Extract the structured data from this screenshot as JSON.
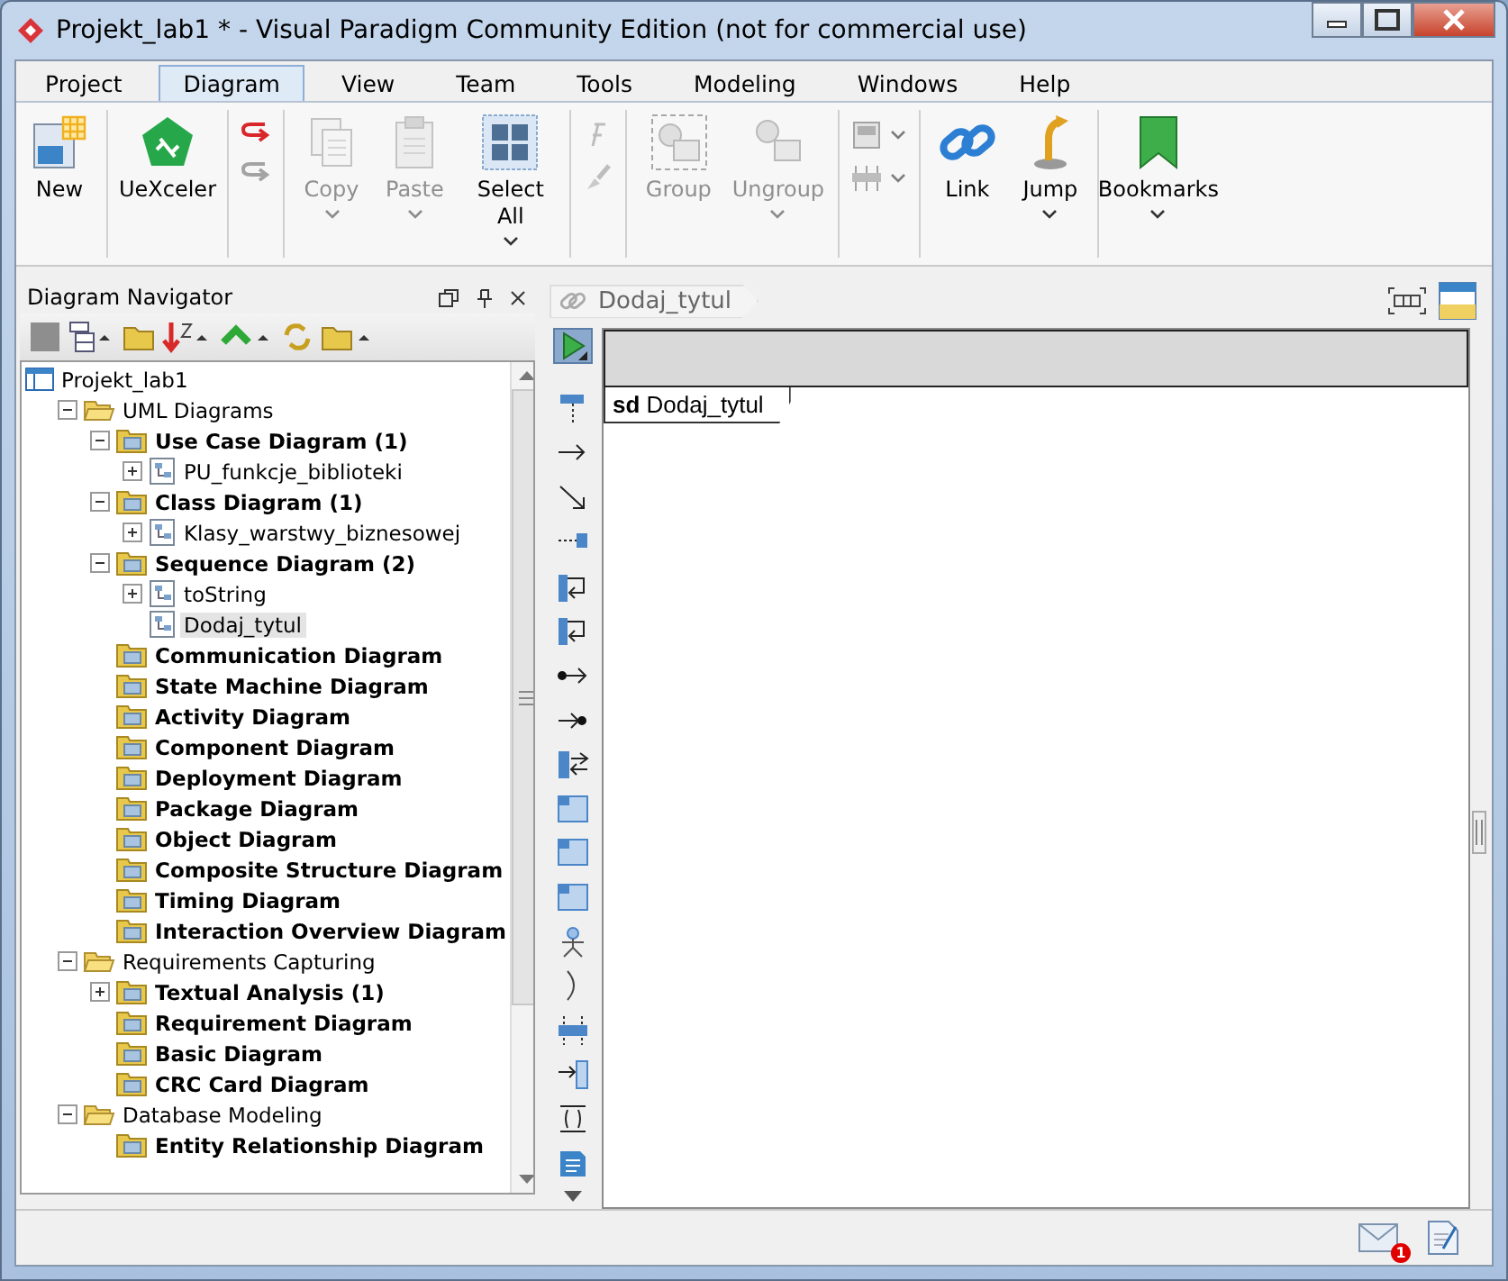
{
  "window": {
    "title": "Projekt_lab1 * - Visual Paradigm Community Edition (not for commercial use)"
  },
  "menu_tabs": [
    {
      "label": "Project",
      "selected": false
    },
    {
      "label": "Diagram",
      "selected": true
    },
    {
      "label": "View",
      "selected": false
    },
    {
      "label": "Team",
      "selected": false
    },
    {
      "label": "Tools",
      "selected": false
    },
    {
      "label": "Modeling",
      "selected": false
    },
    {
      "label": "Windows",
      "selected": false
    },
    {
      "label": "Help",
      "selected": false
    }
  ],
  "ribbon": [
    {
      "kind": "large",
      "buttons": [
        {
          "label": "New",
          "disabled": false,
          "dropdown": false
        }
      ]
    },
    {
      "kind": "large",
      "buttons": [
        {
          "label": "UeXceler",
          "disabled": false,
          "dropdown": false
        }
      ]
    },
    {
      "kind": "small",
      "buttons": [
        {
          "disabled": false,
          "dropdown": false
        },
        {
          "disabled": true,
          "dropdown": false
        }
      ]
    },
    {
      "kind": "large",
      "buttons": [
        {
          "label": "Copy",
          "disabled": true,
          "dropdown": true
        },
        {
          "label": "Paste",
          "disabled": true,
          "dropdown": true
        },
        {
          "label": "Select All",
          "disabled": false,
          "dropdown": true
        }
      ]
    },
    {
      "kind": "small",
      "buttons": [
        {
          "disabled": true,
          "dropdown": false
        },
        {
          "disabled": true,
          "dropdown": false
        }
      ]
    },
    {
      "kind": "large",
      "buttons": [
        {
          "label": "Group",
          "disabled": true,
          "dropdown": false
        },
        {
          "label": "Ungroup",
          "disabled": true,
          "dropdown": true
        }
      ]
    },
    {
      "kind": "small",
      "buttons": [
        {
          "disabled": true,
          "dropdown": true
        },
        {
          "disabled": true,
          "dropdown": true
        }
      ]
    },
    {
      "kind": "large",
      "buttons": [
        {
          "label": "Link",
          "disabled": false,
          "dropdown": false
        },
        {
          "label": "Jump",
          "disabled": false,
          "dropdown": true
        }
      ]
    },
    {
      "kind": "large",
      "buttons": [
        {
          "label": "Bookmarks",
          "disabled": false,
          "dropdown": true
        }
      ]
    }
  ],
  "navigator": {
    "title": "Diagram Navigator",
    "tree": [
      {
        "kind": "project",
        "label": "Projekt_lab1",
        "selected": false,
        "children": [
          {
            "kind": "folder",
            "label": "UML Diagrams",
            "expanded": true,
            "selected": false,
            "children": [
              {
                "kind": "category",
                "label": "Use Case Diagram (1)",
                "expanded": true,
                "selected": false,
                "children": [
                  {
                    "kind": "diagram",
                    "label": "PU_funkcje_biblioteki",
                    "expanded": false,
                    "selected": false
                  }
                ]
              },
              {
                "kind": "category",
                "label": "Class Diagram (1)",
                "expanded": true,
                "selected": false,
                "children": [
                  {
                    "kind": "diagram",
                    "label": "Klasy_warstwy_biznesowej",
                    "expanded": false,
                    "selected": false
                  }
                ]
              },
              {
                "kind": "category",
                "label": "Sequence Diagram (2)",
                "expanded": true,
                "selected": false,
                "children": [
                  {
                    "kind": "diagram",
                    "label": "toString",
                    "expanded": false,
                    "selected": false
                  },
                  {
                    "kind": "diagram",
                    "label": "Dodaj_tytul",
                    "selected": true
                  }
                ]
              },
              {
                "kind": "category",
                "label": "Communication Diagram",
                "selected": false
              },
              {
                "kind": "category",
                "label": "State Machine Diagram",
                "selected": false
              },
              {
                "kind": "category",
                "label": "Activity Diagram",
                "selected": false
              },
              {
                "kind": "category",
                "label": "Component Diagram",
                "selected": false
              },
              {
                "kind": "category",
                "label": "Deployment Diagram",
                "selected": false
              },
              {
                "kind": "category",
                "label": "Package Diagram",
                "selected": false
              },
              {
                "kind": "category",
                "label": "Object Diagram",
                "selected": false
              },
              {
                "kind": "category",
                "label": "Composite Structure Diagram",
                "selected": false
              },
              {
                "kind": "category",
                "label": "Timing Diagram",
                "selected": false
              },
              {
                "kind": "category",
                "label": "Interaction Overview Diagram",
                "selected": false
              }
            ]
          },
          {
            "kind": "folder",
            "label": "Requirements Capturing",
            "expanded": true,
            "selected": false,
            "children": [
              {
                "kind": "category",
                "label": "Textual Analysis (1)",
                "expanded": false,
                "selected": false
              },
              {
                "kind": "category",
                "label": "Requirement Diagram",
                "selected": false
              },
              {
                "kind": "category",
                "label": "Basic Diagram",
                "selected": false
              },
              {
                "kind": "category",
                "label": "CRC Card Diagram",
                "selected": false
              }
            ]
          },
          {
            "kind": "folder",
            "label": "Database Modeling",
            "expanded": true,
            "selected": false,
            "children": [
              {
                "kind": "category",
                "label": "Entity Relationship Diagram",
                "selected": false
              }
            ]
          }
        ]
      }
    ]
  },
  "diagram": {
    "breadcrumb": "Dodaj_tytul",
    "frame_label": "**sd** Dodaj_tytul",
    "palette": [
      {
        "selected": true
      },
      {
        "selected": false
      },
      {
        "selected": false
      },
      {
        "selected": false
      },
      {
        "selected": false
      },
      {
        "selected": false
      },
      {
        "selected": false
      },
      {
        "selected": false
      },
      {
        "selected": false
      },
      {
        "selected": false
      },
      {
        "selected": false
      },
      {
        "selected": false
      },
      {
        "selected": false
      },
      {
        "selected": false
      },
      {
        "selected": false
      },
      {
        "selected": false
      },
      {
        "selected": false
      },
      {
        "selected": false
      },
      {
        "selected": false
      }
    ]
  },
  "status_bar": {
    "notification_count": "1"
  }
}
